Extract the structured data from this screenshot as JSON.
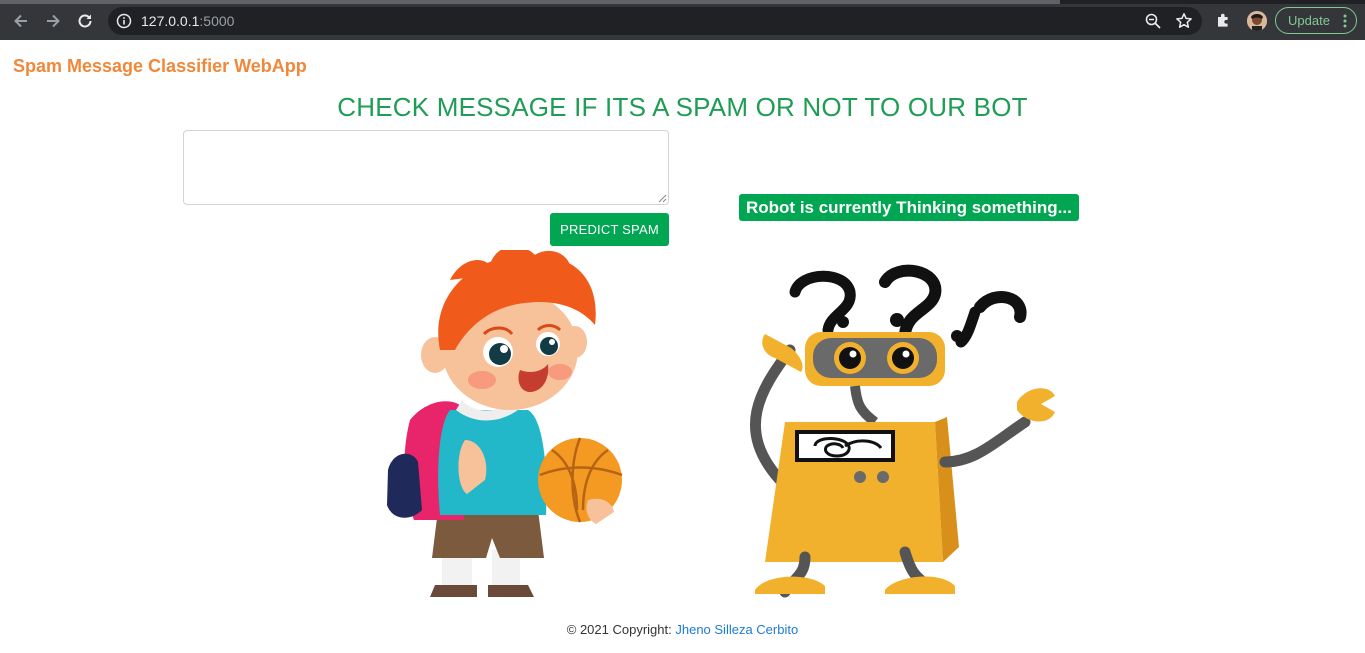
{
  "browser": {
    "url_host": "127.0.0.1",
    "url_rest": ":5000",
    "update_label": "Update",
    "colors": {
      "chrome": "#35363a",
      "omnibox": "#202124",
      "update": "#81c995"
    },
    "icons": [
      "back-arrow-icon",
      "forward-arrow-icon",
      "reload-icon",
      "info-icon",
      "zoom-icon",
      "star-icon",
      "extensions-icon",
      "avatar",
      "more-vert-icon"
    ]
  },
  "navbar": {
    "brand": "Spam Message Classifier WebApp"
  },
  "main": {
    "headline": "CHECK MESSAGE IF ITS A SPAM OR NOT TO OUR BOT",
    "message_value": "",
    "predict_label": "PREDICT SPAM",
    "status_text": "Robot is currently Thinking something..."
  },
  "footer": {
    "copyright": "© 2021 Copyright: ",
    "author": "Jheno Silleza Cerbito"
  },
  "colors": {
    "brand": "#f0883a",
    "headline": "#1f9d55",
    "accent_green": "#00a651",
    "link": "#1e7bd4"
  },
  "illustrations": [
    "boy-with-basketball",
    "thinking-robot"
  ]
}
